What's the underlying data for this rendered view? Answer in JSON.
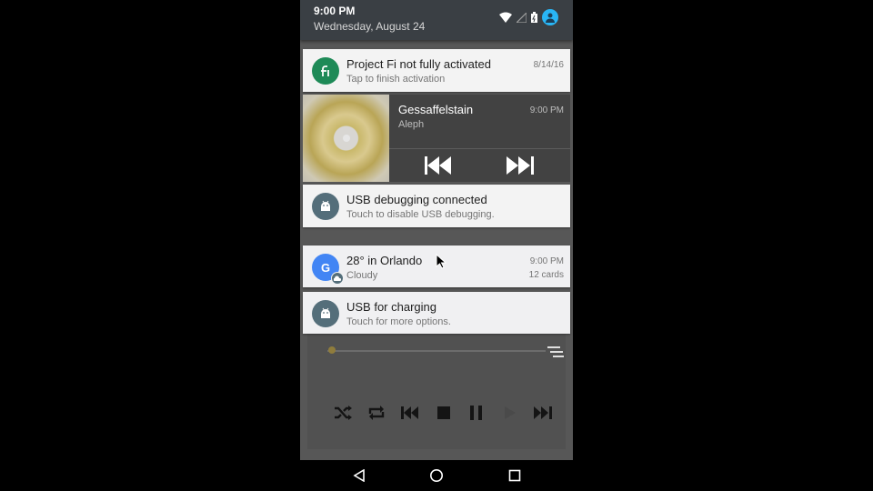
{
  "status": {
    "time": "9:00 PM",
    "date": "Wednesday, August 24"
  },
  "icons": {
    "wifi": "wifi-icon",
    "signal": "signal-icon",
    "battery": "battery-icon",
    "user": "user-avatar-icon"
  },
  "notifications": [
    {
      "id": "project-fi",
      "title": "Project Fi not fully activated",
      "subtitle": "Tap to finish activation",
      "meta": "8/14/16",
      "icon": "project-fi-icon",
      "color": "#1e8a57"
    },
    {
      "id": "usb-debugging",
      "title": "USB debugging connected",
      "subtitle": "Touch to disable USB debugging.",
      "icon": "android-icon",
      "color": "#546e7a"
    },
    {
      "id": "weather",
      "title": "28° in Orlando",
      "subtitle": "Cloudy",
      "meta": "9:00 PM",
      "meta2": "12 cards",
      "icon": "google-icon",
      "color": "#4285f4"
    },
    {
      "id": "usb-charging",
      "title": "USB for charging",
      "subtitle": "Touch for more options.",
      "icon": "android-icon",
      "color": "#546e7a"
    }
  ],
  "media": {
    "artist": "Gessaffelstain",
    "album": "Aleph",
    "time": "9:00 PM",
    "buttons": [
      "previous-icon",
      "next-icon"
    ]
  },
  "player_controls": [
    "shuffle-icon",
    "repeat-icon",
    "skip-previous-icon",
    "stop-icon",
    "pause-icon",
    "play-icon",
    "skip-next-icon"
  ],
  "seek_progress": 0.0,
  "nav": [
    "back-icon",
    "home-icon",
    "recents-icon"
  ]
}
